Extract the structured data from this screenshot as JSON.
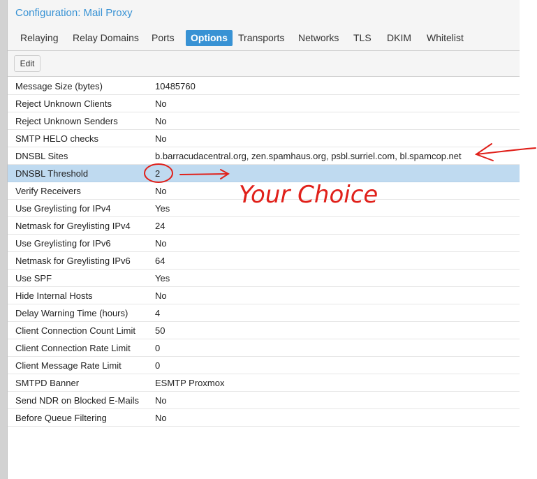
{
  "window": {
    "title": "Configuration: Mail Proxy"
  },
  "tabs": [
    {
      "label": "Relaying",
      "active": false
    },
    {
      "label": "Relay Domains",
      "active": false
    },
    {
      "label": "Ports",
      "active": false
    },
    {
      "label": "Options",
      "active": true
    },
    {
      "label": "Transports",
      "active": false
    },
    {
      "label": "Networks",
      "active": false
    },
    {
      "label": "TLS",
      "active": false
    },
    {
      "label": "DKIM",
      "active": false
    },
    {
      "label": "Whitelist",
      "active": false
    }
  ],
  "toolbar": {
    "edit_label": "Edit"
  },
  "options": [
    {
      "name": "Message Size (bytes)",
      "value": "10485760"
    },
    {
      "name": "Reject Unknown Clients",
      "value": "No"
    },
    {
      "name": "Reject Unknown Senders",
      "value": "No"
    },
    {
      "name": "SMTP HELO checks",
      "value": "No"
    },
    {
      "name": "DNSBL Sites",
      "value": "b.barracudacentral.org, zen.spamhaus.org, psbl.surriel.com, bl.spamcop.net"
    },
    {
      "name": "DNSBL Threshold",
      "value": "2"
    },
    {
      "name": "Verify Receivers",
      "value": "No"
    },
    {
      "name": "Use Greylisting for IPv4",
      "value": "Yes"
    },
    {
      "name": "Netmask for Greylisting IPv4",
      "value": "24"
    },
    {
      "name": "Use Greylisting for IPv6",
      "value": "No"
    },
    {
      "name": "Netmask for Greylisting IPv6",
      "value": "64"
    },
    {
      "name": "Use SPF",
      "value": "Yes"
    },
    {
      "name": "Hide Internal Hosts",
      "value": "No"
    },
    {
      "name": "Delay Warning Time (hours)",
      "value": "4"
    },
    {
      "name": "Client Connection Count Limit",
      "value": "50"
    },
    {
      "name": "Client Connection Rate Limit",
      "value": "0"
    },
    {
      "name": "Client Message Rate Limit",
      "value": "0"
    },
    {
      "name": "SMTPD Banner",
      "value": "ESMTP Proxmox"
    },
    {
      "name": "Send NDR on Blocked E-Mails",
      "value": "No"
    },
    {
      "name": "Before Queue Filtering",
      "value": "No"
    }
  ],
  "selected_row": 5,
  "annotation": {
    "text": "Your Choice",
    "color": "#e0201a"
  },
  "colors": {
    "accent": "#3892d4",
    "selected_row": "#bfdaf0"
  }
}
